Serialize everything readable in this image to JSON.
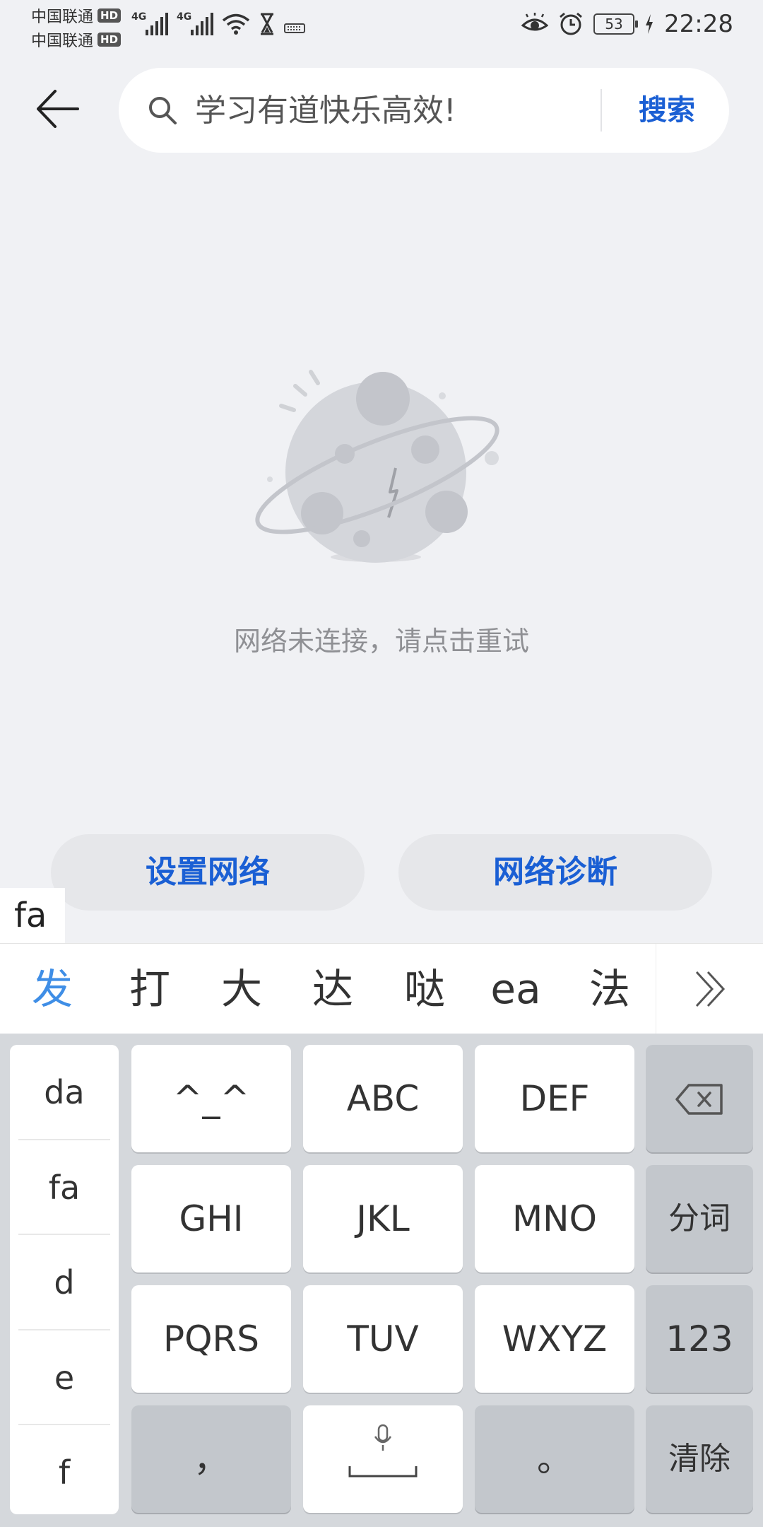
{
  "status_bar": {
    "carrier_1": "中国联通",
    "carrier_2": "中国联通",
    "hd_badge": "HD",
    "network_type": "4G",
    "battery": "53",
    "time": "22:28"
  },
  "header": {
    "search_placeholder": "学习有道快乐高效!",
    "search_button": "搜索"
  },
  "main": {
    "empty_message": "网络未连接，请点击重试",
    "set_network_button": "设置网络",
    "diagnose_button": "网络诊断"
  },
  "ime": {
    "composing_text": "fa",
    "candidates": [
      "发",
      "打",
      "大",
      "达",
      "哒",
      "ea",
      "法"
    ],
    "syllables": [
      "da",
      "fa",
      "d",
      "e",
      "f"
    ],
    "keys": {
      "emoticon": "^_^",
      "abc": "ABC",
      "def": "DEF",
      "ghi": "GHI",
      "jkl": "JKL",
      "mno": "MNO",
      "segment": "分词",
      "pqrs": "PQRS",
      "tuv": "TUV",
      "wxyz": "WXYZ",
      "num": "123",
      "comma": "，",
      "period": "。",
      "clear": "清除"
    }
  },
  "colors": {
    "accent_blue": "#1a5fd4",
    "candidate_selected": "#3f8ee6",
    "background": "#f0f1f4"
  }
}
